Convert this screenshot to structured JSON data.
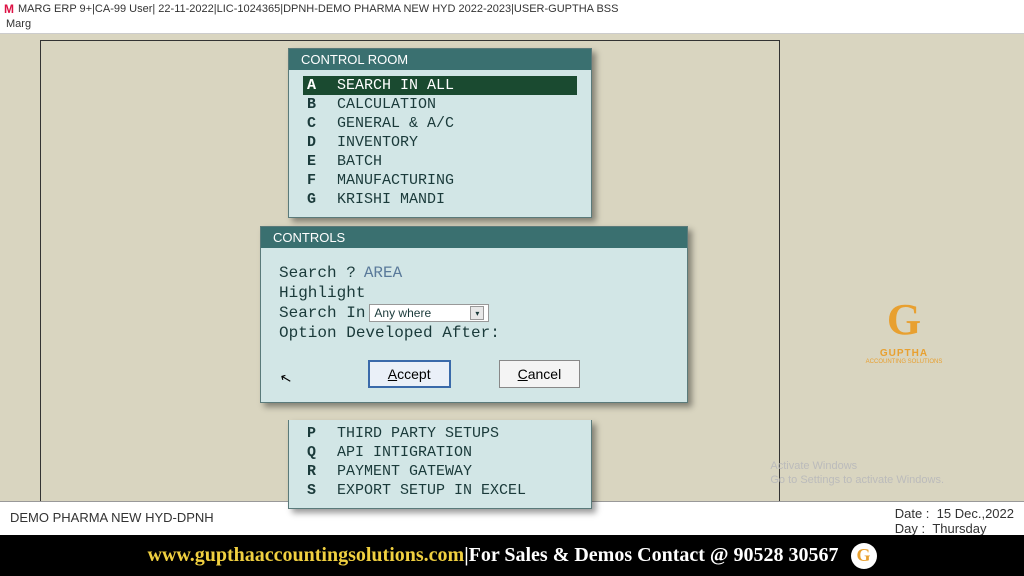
{
  "titlebar": {
    "icon": "M",
    "text": "MARG ERP 9+|CA-99 User| 22-11-2022|LIC-1024365|DPNH-DEMO PHARMA NEW HYD 2022-2023|USER-GUPTHA BSS"
  },
  "menubar": {
    "item": "Marg"
  },
  "control_room": {
    "title": "CONTROL ROOM",
    "items": [
      {
        "key": "A",
        "label": "SEARCH IN ALL",
        "selected": true
      },
      {
        "key": "B",
        "label": "CALCULATION"
      },
      {
        "key": "C",
        "label": "GENERAL & A/C"
      },
      {
        "key": "D",
        "label": "INVENTORY"
      },
      {
        "key": "E",
        "label": "BATCH"
      },
      {
        "key": "F",
        "label": "MANUFACTURING"
      },
      {
        "key": "G",
        "label": "KRISHI MANDI"
      }
    ],
    "items_below": [
      {
        "key": "P",
        "label": "THIRD PARTY SETUPS"
      },
      {
        "key": "Q",
        "label": "API INTIGRATION"
      },
      {
        "key": "R",
        "label": "PAYMENT GATEWAY"
      },
      {
        "key": "S",
        "label": "EXPORT SETUP IN EXCEL"
      }
    ]
  },
  "controls_dialog": {
    "title": "CONTROLS",
    "search_label": "Search ?",
    "search_value": "AREA",
    "highlight_label": "Highlight",
    "search_in_label": "Search In",
    "search_in_value": "Any where",
    "option_dev_label": "Option Developed After:",
    "accept": "Accept",
    "cancel": "Cancel"
  },
  "statusbar": {
    "left": "DEMO PHARMA NEW HYD-DPNH",
    "date_label": "Date  :",
    "date_value": "15 Dec.,2022",
    "day_label": "Day   :",
    "day_value": "Thursday"
  },
  "watermark": {
    "line1": "Activate Windows",
    "line2": "Go to Settings to activate Windows."
  },
  "brand_logo": {
    "letter": "G",
    "name": "GUPTHA",
    "sub": "ACCOUNTING SOLUTIONS"
  },
  "footer": {
    "url": "www.gupthaaccountingsolutions.com",
    "sep": " | ",
    "text": "For Sales & Demos Contact @ 90528 30567",
    "logo_letter": "G"
  }
}
